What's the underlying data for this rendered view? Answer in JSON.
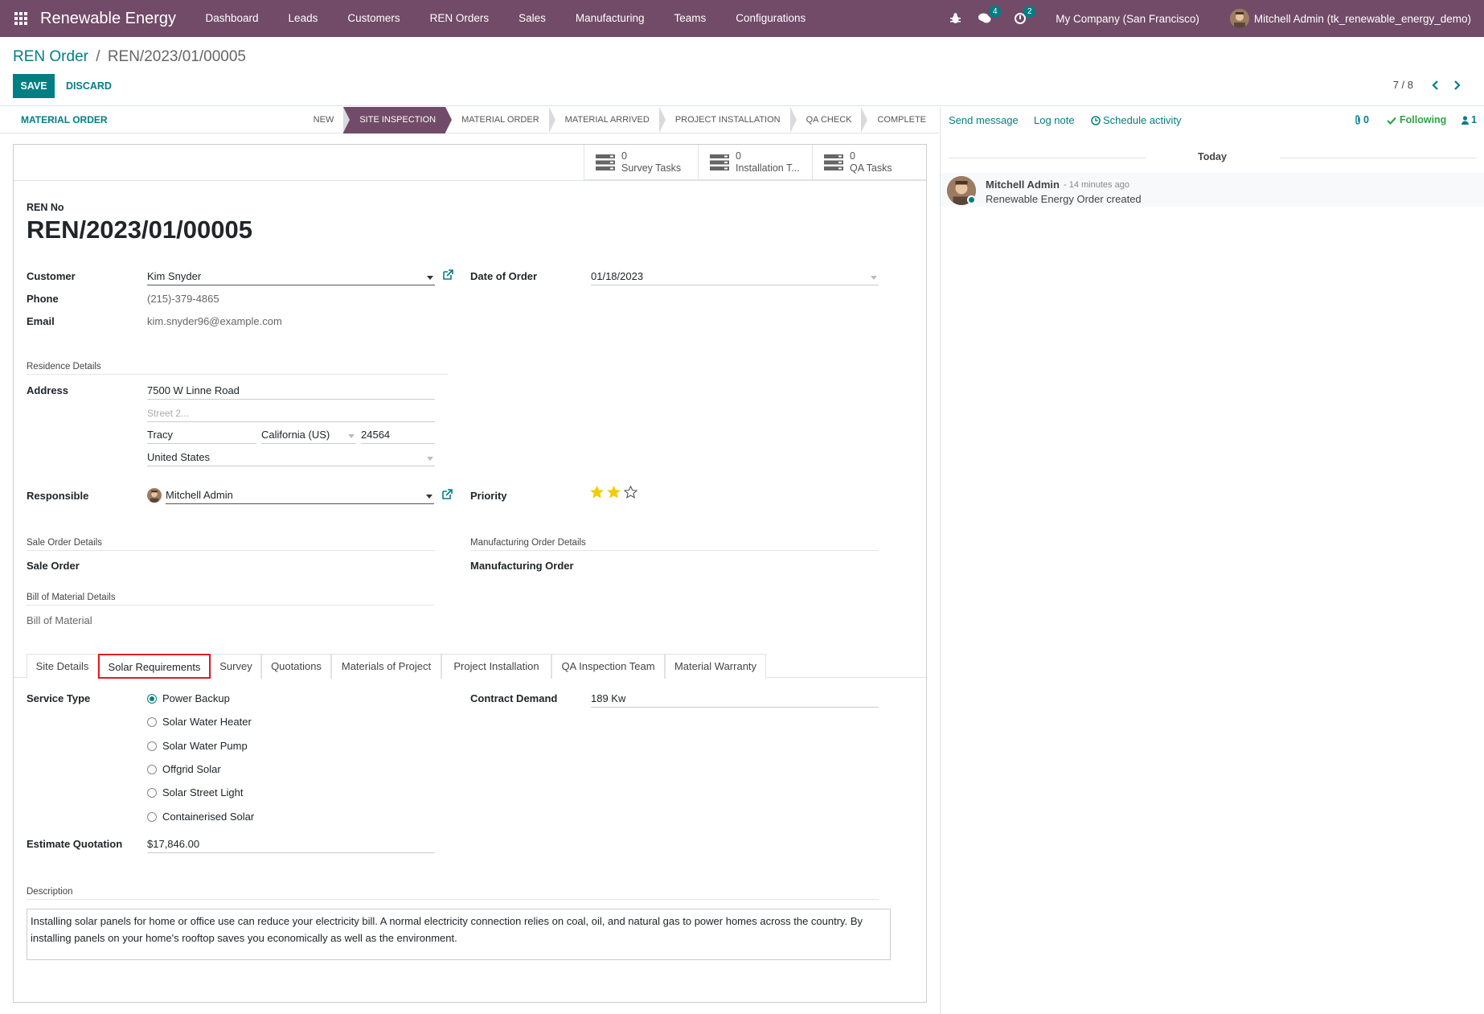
{
  "navbar": {
    "app_name": "Renewable Energy",
    "menu": [
      "Dashboard",
      "Leads",
      "Customers",
      "REN Orders",
      "Sales",
      "Manufacturing",
      "Teams",
      "Configurations"
    ],
    "messages_badge": "4",
    "activities_badge": "2",
    "company": "My Company (San Francisco)",
    "user": "Mitchell Admin (tk_renewable_energy_demo)",
    "accent_color": "#714b67"
  },
  "control": {
    "breadcrumb_parent": "REN Order",
    "breadcrumb_sep": "/",
    "breadcrumb_current": "REN/2023/01/00005",
    "save_label": "SAVE",
    "discard_label": "DISCARD",
    "pager": "7 / 8",
    "primary_color": "#017e84"
  },
  "statusbar": {
    "action_label": "MATERIAL ORDER",
    "stages": [
      "NEW",
      "SITE INSPECTION",
      "MATERIAL ORDER",
      "MATERIAL ARRIVED",
      "PROJECT INSTALLATION",
      "QA CHECK",
      "COMPLETE"
    ],
    "active_stage": "SITE INSPECTION"
  },
  "smart_buttons": [
    {
      "value": "0",
      "label": "Survey Tasks",
      "icon": "tasks-icon"
    },
    {
      "value": "0",
      "label": "Installation T...",
      "icon": "tasks-icon"
    },
    {
      "value": "0",
      "label": "QA Tasks",
      "icon": "tasks-icon"
    }
  ],
  "form": {
    "ren_no_label": "REN No",
    "ren_no": "REN/2023/01/00005",
    "customer_label": "Customer",
    "customer": "Kim Snyder",
    "phone_label": "Phone",
    "phone": "(215)-379-4865",
    "email_label": "Email",
    "email": "kim.snyder96@example.com",
    "date_label": "Date of Order",
    "date": "01/18/2023",
    "residence_title": "Residence Details",
    "address_label": "Address",
    "street": "7500 W Linne Road",
    "street2_placeholder": "Street 2...",
    "city": "Tracy",
    "state": "California (US)",
    "zip": "24564",
    "country": "United States",
    "responsible_label": "Responsible",
    "responsible": "Mitchell Admin",
    "priority_label": "Priority",
    "priority_stars": 2,
    "priority_max": 3,
    "sale_order_title": "Sale Order Details",
    "sale_order_label": "Sale Order",
    "mo_title": "Manufacturing Order Details",
    "mo_label": "Manufacturing Order",
    "bom_title": "Bill of Material Details",
    "bom_label": "Bill of Material"
  },
  "tabs": [
    "Site Details",
    "Solar Requirements",
    "Survey",
    "Quotations",
    "Materials of Project",
    "Project Installation",
    "QA Inspection Team",
    "Material Warranty"
  ],
  "active_tab": "Solar Requirements",
  "solar": {
    "service_type_label": "Service Type",
    "service_types": [
      "Power Backup",
      "Solar Water Heater",
      "Solar Water Pump",
      "Offgrid Solar",
      "Solar Street Light",
      "Containerised Solar"
    ],
    "selected_service": "Power Backup",
    "contract_label": "Contract Demand",
    "contract_value": "189 Kw",
    "estimate_label": "Estimate Quotation",
    "estimate_value": "$17,846.00",
    "description_title": "Description",
    "description": "Installing solar panels for home or office use can reduce your electricity bill. A normal electricity connection relies on coal, oil, and natural gas to power homes across the country. By installing panels on your home's rooftop saves you economically as well as the environment."
  },
  "chatter": {
    "send_message": "Send message",
    "log_note": "Log note",
    "schedule_activity": "Schedule activity",
    "attachments": "0",
    "following": "Following",
    "followers": "1",
    "today_label": "Today",
    "message": {
      "author": "Mitchell Admin",
      "time": "- 14 minutes ago",
      "body": "Renewable Energy Order created"
    }
  }
}
